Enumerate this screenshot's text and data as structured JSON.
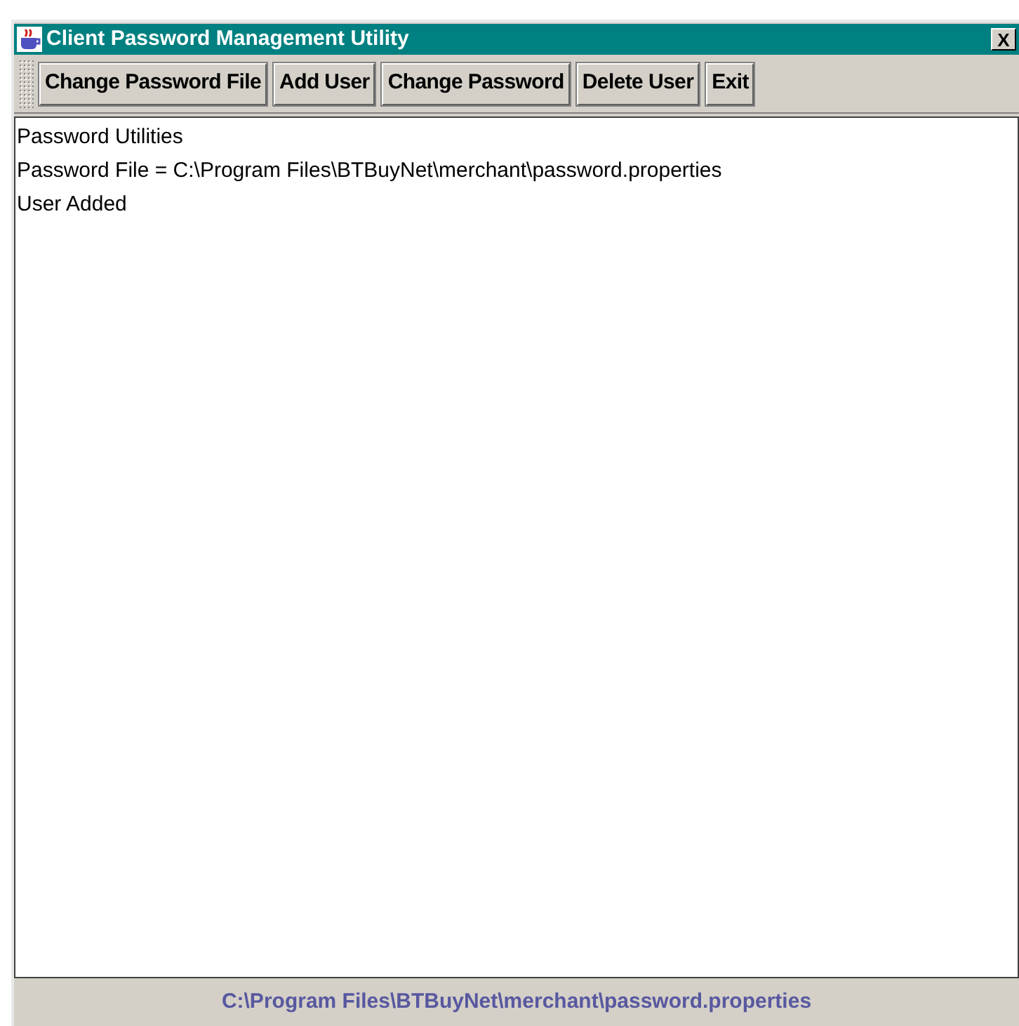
{
  "window": {
    "title": "Client Password Management Utility",
    "close": "X"
  },
  "toolbar": {
    "buttons": [
      "Change Password File",
      "Add User",
      "Change Password",
      "Delete User",
      "Exit"
    ]
  },
  "output_lines": [
    "Password Utilities",
    "Password File = C:\\Program Files\\BTBuyNet\\merchant\\password.properties",
    "User Added"
  ],
  "status_bar": "C:\\Program Files\\BTBuyNet\\merchant\\password.properties"
}
